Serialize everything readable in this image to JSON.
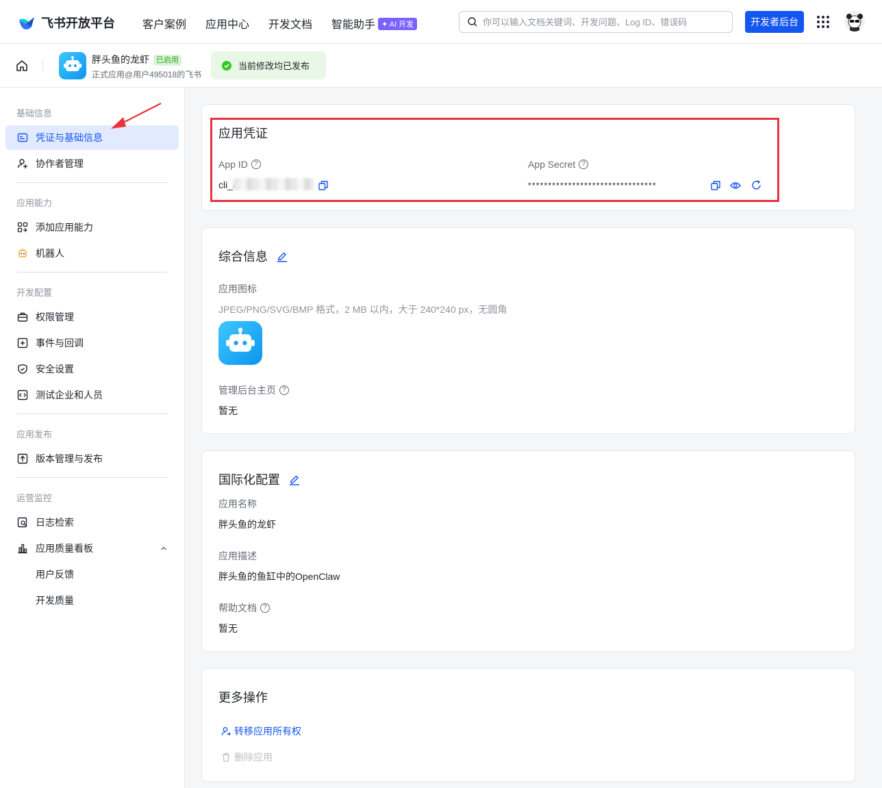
{
  "brand": {
    "name": "飞书开放平台"
  },
  "nav": {
    "links": [
      "客户案例",
      "应用中心",
      "开发文档",
      "智能助手"
    ],
    "ai_badge": "✦ AI 开发",
    "search_placeholder": "你可以输入文档关键词、开发问题、Log ID、错误码",
    "dev_console": "开发者后台"
  },
  "app": {
    "name": "胖头鱼的龙虾",
    "status": "已启用",
    "subtitle": "正式应用@用户495018的飞书",
    "publish_status": "当前修改均已发布"
  },
  "sidebar": {
    "groups": [
      {
        "title": "基础信息",
        "items": [
          "凭证与基础信息",
          "协作者管理"
        ]
      },
      {
        "title": "应用能力",
        "items": [
          "添加应用能力",
          "机器人"
        ]
      },
      {
        "title": "开发配置",
        "items": [
          "权限管理",
          "事件与回调",
          "安全设置",
          "测试企业和人员"
        ]
      },
      {
        "title": "应用发布",
        "items": [
          "版本管理与发布"
        ]
      },
      {
        "title": "运营监控",
        "items": [
          "日志检索",
          "应用质量看板",
          "用户反馈",
          "开发质量"
        ]
      }
    ]
  },
  "credentials": {
    "title": "应用凭证",
    "app_id_label": "App ID",
    "app_id_value": "cli_a",
    "app_secret_label": "App Secret",
    "app_secret_value": "********************************"
  },
  "general": {
    "title": "综合信息",
    "icon_label": "应用图标",
    "icon_hint": "JPEG/PNG/SVG/BMP 格式，2 MB 以内，大于 240*240 px，无圆角",
    "admin_home_label": "管理后台主页",
    "admin_home_value": "暂无"
  },
  "i18n": {
    "title": "国际化配置",
    "name_label": "应用名称",
    "name_value": "胖头鱼的龙虾",
    "desc_label": "应用描述",
    "desc_value": "胖头鱼的鱼缸中的OpenClaw",
    "help_label": "帮助文档",
    "help_value": "暂无"
  },
  "more": {
    "title": "更多操作",
    "transfer": "转移应用所有权",
    "delete": "删除应用"
  },
  "colors": {
    "accent": "#1456f0",
    "highlight": "#e8323c",
    "success": "#34c724"
  }
}
